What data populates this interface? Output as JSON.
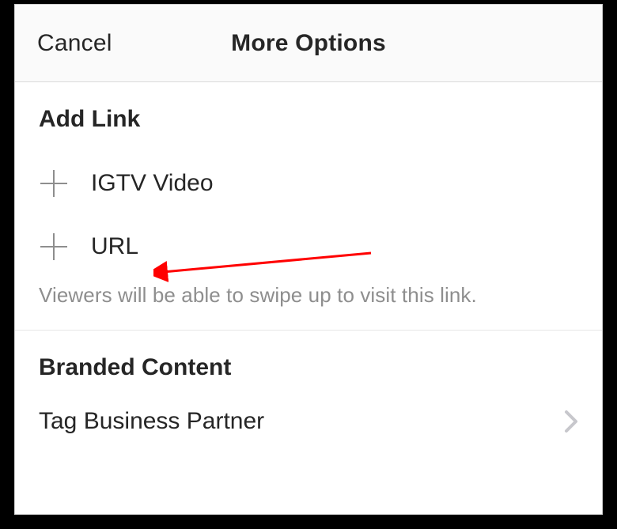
{
  "header": {
    "cancel": "Cancel",
    "title": "More Options"
  },
  "addLink": {
    "title": "Add Link",
    "items": [
      {
        "label": "IGTV Video"
      },
      {
        "label": "URL"
      }
    ],
    "helper": "Viewers will be able to swipe up to visit this link."
  },
  "branded": {
    "title": "Branded Content",
    "partner": "Tag Business Partner"
  }
}
